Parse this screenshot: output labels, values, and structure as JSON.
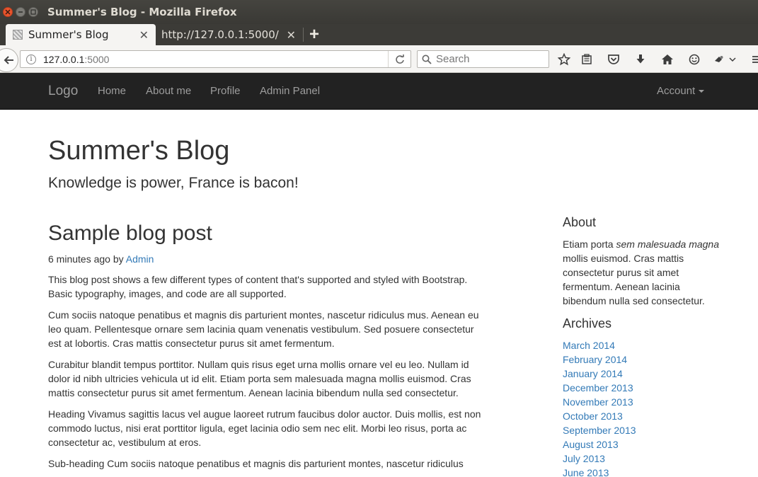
{
  "window": {
    "title": "Summer's Blog - Mozilla Firefox"
  },
  "tabs": [
    {
      "label": "Summer's Blog",
      "active": true
    },
    {
      "label": "http://127.0.0.1:5000/",
      "active": false
    }
  ],
  "toolbar": {
    "url_host": "127.0.0.1",
    "url_port": ":5000",
    "search_placeholder": "Search",
    "new_tab_symbol": "+",
    "icons": [
      "back-icon",
      "info-icon",
      "reload-icon",
      "search-icon",
      "bookmark-star-icon",
      "reading-list-icon",
      "pocket-icon",
      "download-icon",
      "home-icon",
      "emoji-icon",
      "extension-icon",
      "menu-icon"
    ]
  },
  "sitenav": {
    "brand": "Logo",
    "links": [
      "Home",
      "About me",
      "Profile",
      "Admin Panel"
    ],
    "account": "Account"
  },
  "blog": {
    "title": "Summer's Blog",
    "description": "Knowledge is power, France is bacon!"
  },
  "post": {
    "title": "Sample blog post",
    "meta_prefix": "6 minutes ago by",
    "author": "Admin",
    "paragraphs": [
      "This blog post shows a few different types of content that's supported and styled with Bootstrap. Basic typography, images, and code are all supported.",
      "Cum sociis natoque penatibus et magnis dis parturient montes, nascetur ridiculus mus. Aenean eu leo quam. Pellentesque ornare sem lacinia quam venenatis vestibulum. Sed posuere consectetur est at lobortis. Cras mattis consectetur purus sit amet fermentum.",
      "Curabitur blandit tempus porttitor. Nullam quis risus eget urna mollis ornare vel eu leo. Nullam id dolor id nibh ultricies vehicula ut id elit. Etiam porta sem malesuada magna mollis euismod. Cras mattis consectetur purus sit amet fermentum. Aenean lacinia bibendum nulla sed consectetur.",
      "Heading Vivamus sagittis lacus vel augue laoreet rutrum faucibus dolor auctor. Duis mollis, est non commodo luctus, nisi erat porttitor ligula, eget lacinia odio sem nec elit. Morbi leo risus, porta ac consectetur ac, vestibulum at eros.",
      "Sub-heading Cum sociis natoque penatibus et magnis dis parturient montes, nascetur ridiculus"
    ]
  },
  "sidebar": {
    "about_heading": "About",
    "about_text_1": "Etiam porta ",
    "about_text_em": "sem malesuada magna",
    "about_text_2": " mollis euismod. Cras mattis consectetur purus sit amet fermentum. Aenean lacinia bibendum nulla sed consectetur.",
    "archives_heading": "Archives",
    "archives": [
      "March 2014",
      "February 2014",
      "January 2014",
      "December 2013",
      "November 2013",
      "October 2013",
      "September 2013",
      "August 2013",
      "July 2013",
      "June 2013"
    ]
  },
  "colors": {
    "link": "#337ab7",
    "navbar_bg": "#222222",
    "close_button": "#e9542d"
  }
}
